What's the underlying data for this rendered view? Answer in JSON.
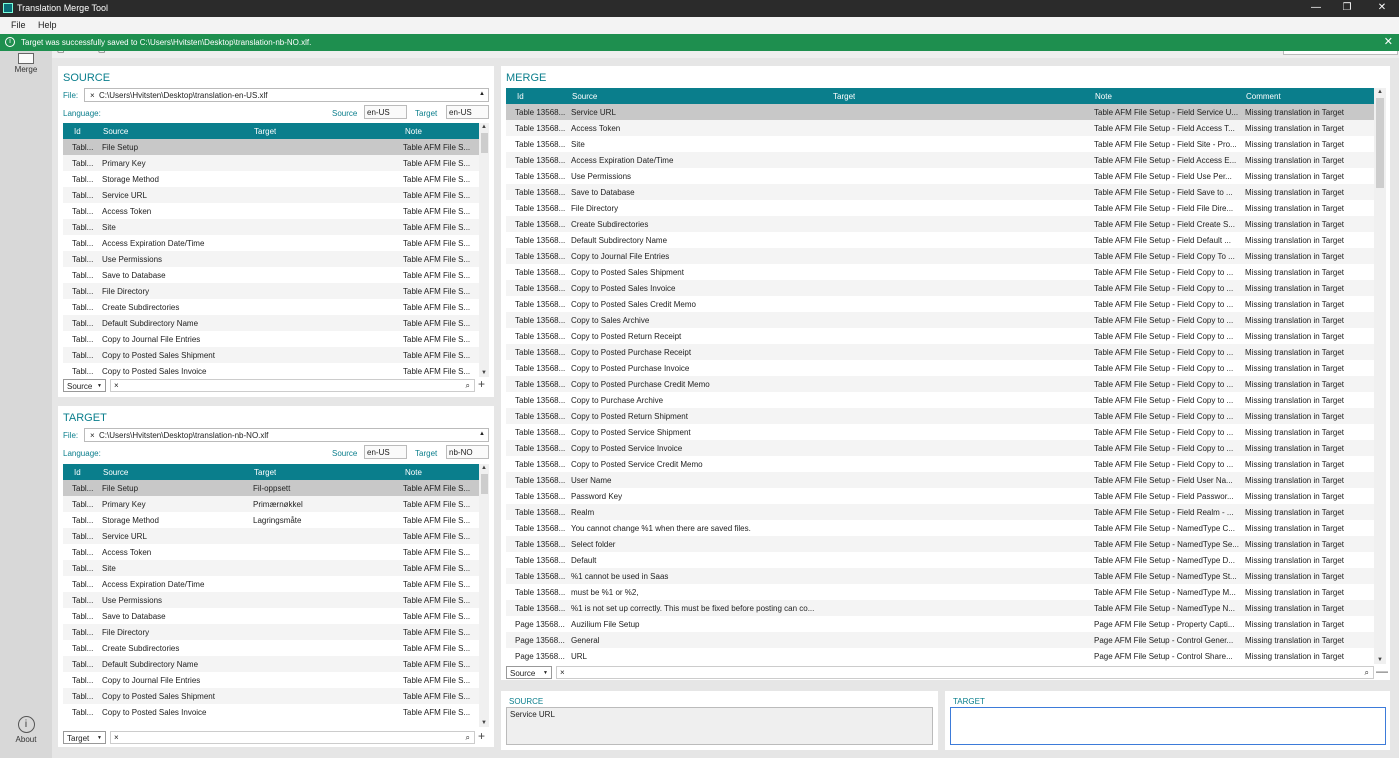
{
  "window": {
    "title": "Translation Merge Tool"
  },
  "menu": [
    "File",
    "Help"
  ],
  "notification": {
    "message": "Target was successfully saved to C:\\Users\\Hvitsten\\Desktop\\translation-nb-NO.xlf."
  },
  "sidebar": {
    "merge_label": "Merge",
    "about_label": "About"
  },
  "colors": {
    "accent": "#0a7e8c",
    "notification": "#1e8f4f",
    "titlebar": "#2b2b2b"
  },
  "source_panel": {
    "title": "SOURCE",
    "file_label": "File:",
    "file_path": "C:\\Users\\Hvitsten\\Desktop\\translation-en-US.xlf",
    "language_label": "Language:",
    "source_label": "Source",
    "source_lang": "en-US",
    "target_label": "Target",
    "target_lang": "en-US",
    "columns": [
      "Id",
      "Source",
      "Target",
      "Note"
    ],
    "rows": [
      [
        "Tabl...",
        "File Setup",
        "",
        "Table AFM File S..."
      ],
      [
        "Tabl...",
        "Primary Key",
        "",
        "Table AFM File S..."
      ],
      [
        "Tabl...",
        "Storage Method",
        "",
        "Table AFM File S..."
      ],
      [
        "Tabl...",
        "Service URL",
        "",
        "Table AFM File S..."
      ],
      [
        "Tabl...",
        "Access Token",
        "",
        "Table AFM File S..."
      ],
      [
        "Tabl...",
        "Site",
        "",
        "Table AFM File S..."
      ],
      [
        "Tabl...",
        "Access Expiration Date/Time",
        "",
        "Table AFM File S..."
      ],
      [
        "Tabl...",
        "Use Permissions",
        "",
        "Table AFM File S..."
      ],
      [
        "Tabl...",
        "Save to Database",
        "",
        "Table AFM File S..."
      ],
      [
        "Tabl...",
        "File Directory",
        "",
        "Table AFM File S..."
      ],
      [
        "Tabl...",
        "Create Subdirectories",
        "",
        "Table AFM File S..."
      ],
      [
        "Tabl...",
        "Default Subdirectory Name",
        "",
        "Table AFM File S..."
      ],
      [
        "Tabl...",
        "Copy to Journal File Entries",
        "",
        "Table AFM File S..."
      ],
      [
        "Tabl...",
        "Copy to Posted Sales Shipment",
        "",
        "Table AFM File S..."
      ],
      [
        "Tabl...",
        "Copy to Posted Sales Invoice",
        "",
        "Table AFM File S..."
      ]
    ],
    "search_field": "Source"
  },
  "target_panel": {
    "title": "TARGET",
    "file_label": "File:",
    "file_path": "C:\\Users\\Hvitsten\\Desktop\\translation-nb-NO.xlf",
    "language_label": "Language:",
    "source_label": "Source",
    "source_lang": "en-US",
    "target_label": "Target",
    "target_lang": "nb-NO",
    "columns": [
      "Id",
      "Source",
      "Target",
      "Note"
    ],
    "rows": [
      [
        "Tabl...",
        "File Setup",
        "Fil-oppsett",
        "Table AFM File S..."
      ],
      [
        "Tabl...",
        "Primary Key",
        "Primærnøkkel",
        "Table AFM File S..."
      ],
      [
        "Tabl...",
        "Storage Method",
        "Lagringsmåte",
        "Table AFM File S..."
      ],
      [
        "Tabl...",
        "Service URL",
        "",
        "Table AFM File S..."
      ],
      [
        "Tabl...",
        "Access Token",
        "",
        "Table AFM File S..."
      ],
      [
        "Tabl...",
        "Site",
        "",
        "Table AFM File S..."
      ],
      [
        "Tabl...",
        "Access Expiration Date/Time",
        "",
        "Table AFM File S..."
      ],
      [
        "Tabl...",
        "Use Permissions",
        "",
        "Table AFM File S..."
      ],
      [
        "Tabl...",
        "Save to Database",
        "",
        "Table AFM File S..."
      ],
      [
        "Tabl...",
        "File Directory",
        "",
        "Table AFM File S..."
      ],
      [
        "Tabl...",
        "Create Subdirectories",
        "",
        "Table AFM File S..."
      ],
      [
        "Tabl...",
        "Default Subdirectory Name",
        "",
        "Table AFM File S..."
      ],
      [
        "Tabl...",
        "Copy to Journal File Entries",
        "",
        "Table AFM File S..."
      ],
      [
        "Tabl...",
        "Copy to Posted Sales Shipment",
        "",
        "Table AFM File S..."
      ],
      [
        "Tabl...",
        "Copy to Posted Sales Invoice",
        "",
        "Table AFM File S..."
      ]
    ],
    "search_field": "Target"
  },
  "merge_panel": {
    "title": "MERGE",
    "columns": [
      "Id",
      "Source",
      "Target",
      "Note",
      "Comment"
    ],
    "rows": [
      [
        "Table 13568...",
        "Service URL",
        "",
        "Table AFM File Setup - Field Service U...",
        "Missing translation in Target"
      ],
      [
        "Table 13568...",
        "Access Token",
        "",
        "Table AFM File Setup - Field Access T...",
        "Missing translation in Target"
      ],
      [
        "Table 13568...",
        "Site",
        "",
        "Table AFM File Setup - Field Site - Pro...",
        "Missing translation in Target"
      ],
      [
        "Table 13568...",
        "Access Expiration Date/Time",
        "",
        "Table AFM File Setup - Field Access E...",
        "Missing translation in Target"
      ],
      [
        "Table 13568...",
        "Use Permissions",
        "",
        "Table AFM File Setup - Field Use Per...",
        "Missing translation in Target"
      ],
      [
        "Table 13568...",
        "Save to Database",
        "",
        "Table AFM File Setup - Field Save to ...",
        "Missing translation in Target"
      ],
      [
        "Table 13568...",
        "File Directory",
        "",
        "Table AFM File Setup - Field File Dire...",
        "Missing translation in Target"
      ],
      [
        "Table 13568...",
        "Create Subdirectories",
        "",
        "Table AFM File Setup - Field Create S...",
        "Missing translation in Target"
      ],
      [
        "Table 13568...",
        "Default Subdirectory Name",
        "",
        "Table AFM File Setup - Field Default ...",
        "Missing translation in Target"
      ],
      [
        "Table 13568...",
        "Copy to Journal File Entries",
        "",
        "Table AFM File Setup - Field Copy To ...",
        "Missing translation in Target"
      ],
      [
        "Table 13568...",
        "Copy to Posted Sales Shipment",
        "",
        "Table AFM File Setup - Field Copy to ...",
        "Missing translation in Target"
      ],
      [
        "Table 13568...",
        "Copy to Posted Sales Invoice",
        "",
        "Table AFM File Setup - Field Copy to ...",
        "Missing translation in Target"
      ],
      [
        "Table 13568...",
        "Copy to Posted Sales Credit Memo",
        "",
        "Table AFM File Setup - Field Copy to ...",
        "Missing translation in Target"
      ],
      [
        "Table 13568...",
        "Copy to Sales Archive",
        "",
        "Table AFM File Setup - Field Copy to ...",
        "Missing translation in Target"
      ],
      [
        "Table 13568...",
        "Copy to Posted Return Receipt",
        "",
        "Table AFM File Setup - Field Copy to ...",
        "Missing translation in Target"
      ],
      [
        "Table 13568...",
        "Copy to Posted Purchase Receipt",
        "",
        "Table AFM File Setup - Field Copy to ...",
        "Missing translation in Target"
      ],
      [
        "Table 13568...",
        "Copy to Posted Purchase Invoice",
        "",
        "Table AFM File Setup - Field Copy to ...",
        "Missing translation in Target"
      ],
      [
        "Table 13568...",
        "Copy to Posted Purchase Credit Memo",
        "",
        "Table AFM File Setup - Field Copy to ...",
        "Missing translation in Target"
      ],
      [
        "Table 13568...",
        "Copy to Purchase Archive",
        "",
        "Table AFM File Setup - Field Copy to ...",
        "Missing translation in Target"
      ],
      [
        "Table 13568...",
        "Copy to Posted Return Shipment",
        "",
        "Table AFM File Setup - Field Copy to ...",
        "Missing translation in Target"
      ],
      [
        "Table 13568...",
        "Copy to Posted Service Shipment",
        "",
        "Table AFM File Setup - Field Copy to ...",
        "Missing translation in Target"
      ],
      [
        "Table 13568...",
        "Copy to Posted Service Invoice",
        "",
        "Table AFM File Setup - Field Copy to ...",
        "Missing translation in Target"
      ],
      [
        "Table 13568...",
        "Copy to Posted Service Credit Memo",
        "",
        "Table AFM File Setup - Field Copy to ...",
        "Missing translation in Target"
      ],
      [
        "Table 13568...",
        "User Name",
        "",
        "Table AFM File Setup - Field User Na...",
        "Missing translation in Target"
      ],
      [
        "Table 13568...",
        "Password Key",
        "",
        "Table AFM File Setup - Field Passwor...",
        "Missing translation in Target"
      ],
      [
        "Table 13568...",
        "Realm",
        "",
        "Table AFM File Setup - Field Realm - ...",
        "Missing translation in Target"
      ],
      [
        "Table 13568...",
        "You cannot change %1 when there are saved files.",
        "",
        "Table AFM File Setup - NamedType C...",
        "Missing translation in Target"
      ],
      [
        "Table 13568...",
        "Select folder",
        "",
        "Table AFM File Setup - NamedType Se...",
        "Missing translation in Target"
      ],
      [
        "Table 13568...",
        "Default",
        "",
        "Table AFM File Setup - NamedType D...",
        "Missing translation in Target"
      ],
      [
        "Table 13568...",
        "%1 cannot be used in Saas",
        "",
        "Table AFM File Setup - NamedType St...",
        "Missing translation in Target"
      ],
      [
        "Table 13568...",
        "must be %1 or %2,",
        "",
        "Table AFM File Setup - NamedType M...",
        "Missing translation in Target"
      ],
      [
        "Table 13568...",
        "%1 is not set up correctly. This must be fixed before posting can co...",
        "",
        "Table AFM File Setup - NamedType N...",
        "Missing translation in Target"
      ],
      [
        "Page 13568...",
        "Auzilium File Setup",
        "",
        "Page AFM File Setup - Property Capti...",
        "Missing translation in Target"
      ],
      [
        "Page 13568...",
        "General",
        "",
        "Page AFM File Setup - Control Gener...",
        "Missing translation in Target"
      ],
      [
        "Page 13568...",
        "URL",
        "",
        "Page AFM File Setup - Control Share...",
        "Missing translation in Target"
      ]
    ],
    "search_field": "Source"
  },
  "bottom": {
    "source_label": "SOURCE",
    "source_text": "Service URL",
    "target_label": "TARGET",
    "target_text": ""
  }
}
